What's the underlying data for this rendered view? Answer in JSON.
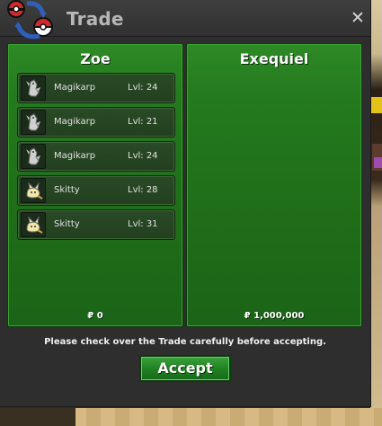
{
  "window": {
    "title": "Trade",
    "close_label": "✕"
  },
  "trade": {
    "left": {
      "name": "Zoe",
      "money": "₽ 0",
      "slots": [
        {
          "name": "Magikarp",
          "level": "Lvl: 24",
          "icon": "magikarp-icon"
        },
        {
          "name": "Magikarp",
          "level": "Lvl: 21",
          "icon": "magikarp-icon"
        },
        {
          "name": "Magikarp",
          "level": "Lvl: 24",
          "icon": "magikarp-icon"
        },
        {
          "name": "Skitty",
          "level": "Lvl: 28",
          "icon": "skitty-icon"
        },
        {
          "name": "Skitty",
          "level": "Lvl: 31",
          "icon": "skitty-icon"
        }
      ]
    },
    "right": {
      "name": "Exequiel",
      "money": "₽ 1,000,000",
      "slots": []
    }
  },
  "footer": {
    "notice": "Please check over the Trade carefully before accepting.",
    "accept_label": "Accept"
  },
  "colors": {
    "panel_green": "#247a1e",
    "button_green": "#1f7f22",
    "window_bg": "#2e2e2e"
  }
}
